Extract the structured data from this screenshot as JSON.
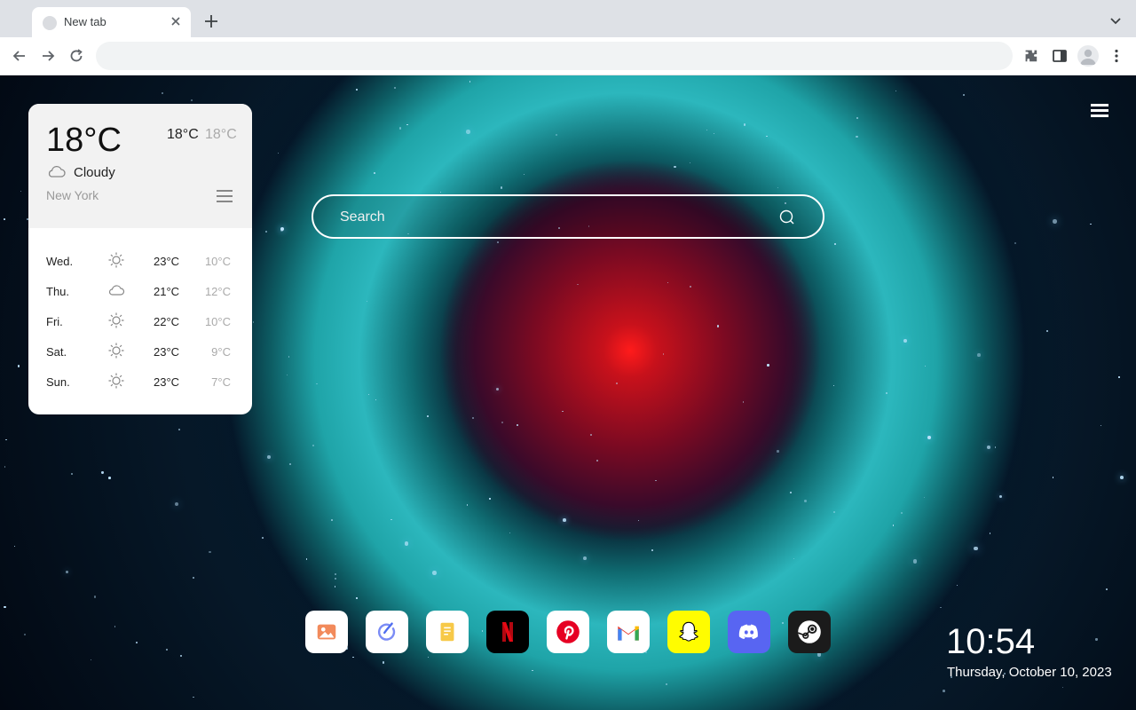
{
  "browser": {
    "tab_title": "New tab",
    "address_placeholder": ""
  },
  "weather": {
    "current_temp": "18°C",
    "high": "18°C",
    "low": "18°C",
    "condition": "Cloudy",
    "condition_icon": "cloud-icon",
    "city": "New York",
    "forecast": [
      {
        "day": "Wed.",
        "icon": "sun-icon",
        "high": "23°C",
        "low": "10°C"
      },
      {
        "day": "Thu.",
        "icon": "cloud-icon",
        "high": "21°C",
        "low": "12°C"
      },
      {
        "day": "Fri.",
        "icon": "sun-icon",
        "high": "22°C",
        "low": "10°C"
      },
      {
        "day": "Sat.",
        "icon": "sun-icon",
        "high": "23°C",
        "low": "9°C"
      },
      {
        "day": "Sun.",
        "icon": "sun-icon",
        "high": "23°C",
        "low": "7°C"
      }
    ]
  },
  "search": {
    "placeholder": "Search"
  },
  "shortcuts": [
    {
      "name": "photos-app",
      "icon": "image-icon",
      "color": "#ffffff"
    },
    {
      "name": "tasks-app",
      "icon": "check-circle-icon",
      "color": "#ffffff"
    },
    {
      "name": "notes-app",
      "icon": "note-icon",
      "color": "#ffffff"
    },
    {
      "name": "netflix-app",
      "icon": "netflix-icon",
      "color": "#000000"
    },
    {
      "name": "pinterest-app",
      "icon": "pinterest-icon",
      "color": "#ffffff"
    },
    {
      "name": "gmail-app",
      "icon": "gmail-icon",
      "color": "#ffffff"
    },
    {
      "name": "snapchat-app",
      "icon": "snapchat-icon",
      "color": "#fffc00"
    },
    {
      "name": "discord-app",
      "icon": "discord-icon",
      "color": "#5865f2"
    },
    {
      "name": "steam-app",
      "icon": "steam-icon",
      "color": "#1b1b1b"
    }
  ],
  "clock": {
    "time": "10:54",
    "date": "Thursday, October 10, 2023"
  }
}
